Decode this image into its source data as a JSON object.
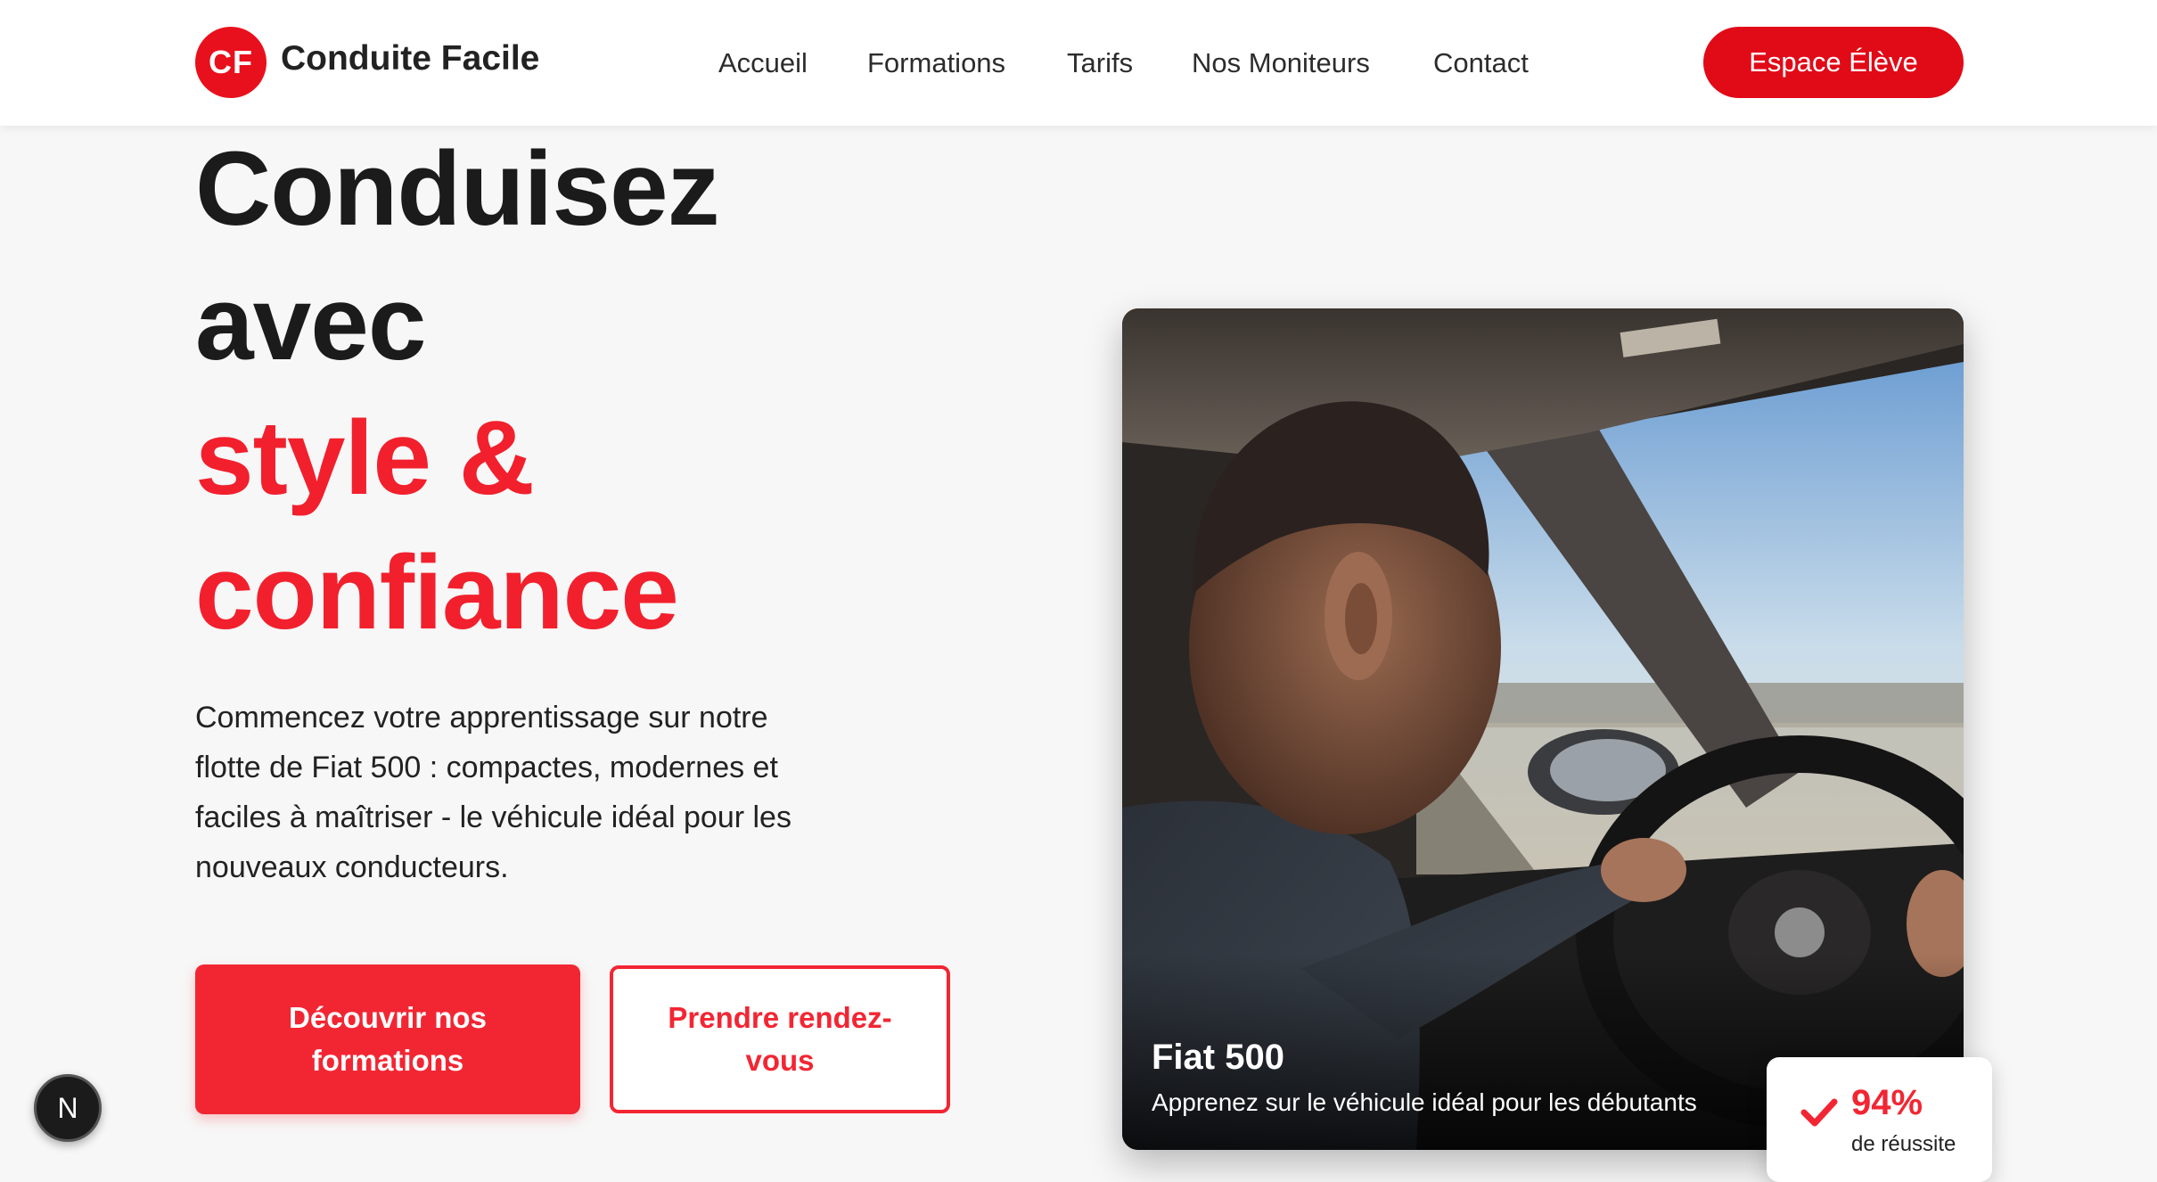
{
  "brand": {
    "initials": "CF",
    "name": "Conduite Facile",
    "accent_color": "#e10a17"
  },
  "nav": {
    "items": [
      {
        "label": "Accueil"
      },
      {
        "label": "Formations"
      },
      {
        "label": "Tarifs"
      },
      {
        "label": "Nos Moniteurs"
      },
      {
        "label": "Contact"
      }
    ],
    "cta_label": "Espace Élève"
  },
  "hero": {
    "title_line1": "Conduisez",
    "title_line2": "avec",
    "title_highlight_line1": "style &",
    "title_highlight_line2": "confiance",
    "description": "Commencez votre apprentissage sur notre flotte de Fiat 500 : compactes, modernes et faciles à maîtriser - le véhicule idéal pour les nouveaux conducteurs.",
    "primary_button": "Découvrir nos formations",
    "secondary_button": "Prendre rendez-vous"
  },
  "feature_card": {
    "title": "Fiat 500",
    "subtitle": "Apprenez sur le véhicule idéal pour les débutants"
  },
  "stat": {
    "icon": "check-icon",
    "value": "94%",
    "label": "de réussite"
  },
  "floating_badge": {
    "letter": "N"
  }
}
